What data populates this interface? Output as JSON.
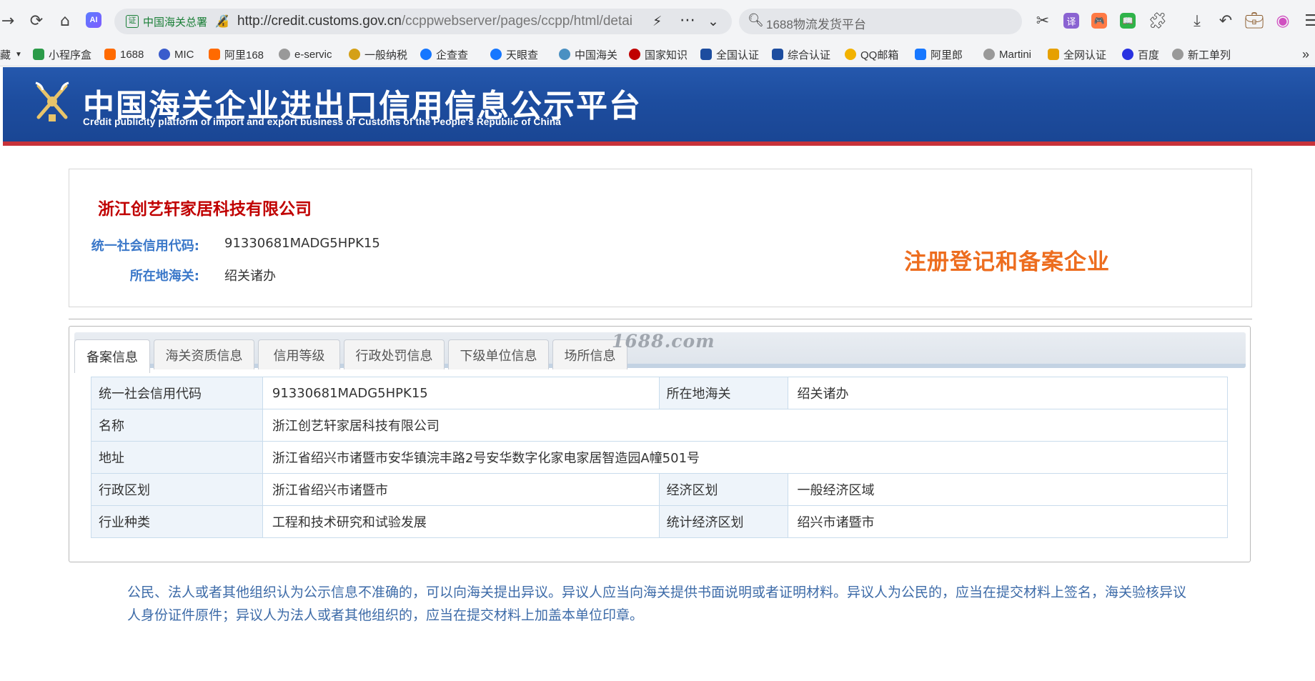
{
  "browser": {
    "site_chip": "中国海关总署",
    "site_chip_badge": "证",
    "url_main": "http://credit.customs.gov.cn",
    "url_rest": "/ccppwebserver/pages/ccpp/html/detai",
    "search_text": "1688物流发货平台",
    "ai_badge": "AI",
    "extensions": [
      {
        "icon": "translate-icon",
        "label": "译",
        "color": "#8a63d2"
      },
      {
        "icon": "game-icon",
        "label": "🎮",
        "color": "#ff7a45"
      },
      {
        "icon": "book-icon",
        "label": "📖",
        "color": "#2fb34a"
      }
    ]
  },
  "bookmarks": [
    {
      "label": "藏",
      "color": "#f3f4f6"
    },
    {
      "label": "小程序盒",
      "color": "#2b9b49"
    },
    {
      "label": "1688",
      "color": "#ff6a00"
    },
    {
      "label": "MIC",
      "color": "#3a5ccc"
    },
    {
      "label": "阿里168",
      "color": "#ff6a00"
    },
    {
      "label": "e-servic",
      "color": "#999999"
    },
    {
      "label": "一般纳税",
      "color": "#d4a017"
    },
    {
      "label": "企查查",
      "color": "#1677ff"
    },
    {
      "label": "天眼查",
      "color": "#1677ff"
    },
    {
      "label": "中国海关",
      "color": "#4a90c2"
    },
    {
      "label": "国家知识",
      "color": "#c00000"
    },
    {
      "label": "全国认证",
      "color": "#1d4d9f"
    },
    {
      "label": "综合认证",
      "color": "#1d4d9f"
    },
    {
      "label": "QQ邮箱",
      "color": "#f2b200"
    },
    {
      "label": "阿里郎",
      "color": "#1677ff"
    },
    {
      "label": "Martini",
      "color": "#999999"
    },
    {
      "label": "全网认证",
      "color": "#e6a000"
    },
    {
      "label": "百度",
      "color": "#2932e1"
    },
    {
      "label": "新工单列",
      "color": "#999999"
    }
  ],
  "banner": {
    "title": "中国海关企业进出口信用信息公示平台",
    "subtitle": "Credit publicity platform of import and export business of Customs of the People's Republic of China"
  },
  "company": {
    "name": "浙江创艺轩家居科技有限公司",
    "credit_code_label": "统一社会信用代码:",
    "credit_code": "91330681MADG5HPK15",
    "customs_label": "所在地海关:",
    "customs": "绍关诸办",
    "status_stamp": "注册登记和备案企业"
  },
  "tabs": [
    {
      "label": "备案信息",
      "active": true
    },
    {
      "label": "海关资质信息",
      "active": false
    },
    {
      "label": "信用等级",
      "active": false
    },
    {
      "label": "行政处罚信息",
      "active": false
    },
    {
      "label": "下级单位信息",
      "active": false
    },
    {
      "label": "场所信息",
      "active": false
    }
  ],
  "watermark": "1688.com",
  "details": {
    "r1": {
      "l1": "统一社会信用代码",
      "v1": "91330681MADG5HPK15",
      "l2": "所在地海关",
      "v2": "绍关诸办"
    },
    "r2": {
      "l1": "名称",
      "v1": "浙江创艺轩家居科技有限公司"
    },
    "r3": {
      "l1": "地址",
      "v1": "浙江省绍兴市诸暨市安华镇浣丰路2号安华数字化家电家居智造园A幢501号"
    },
    "r4": {
      "l1": "行政区划",
      "v1": "浙江省绍兴市诸暨市",
      "l2": "经济区划",
      "v2": "一般经济区域"
    },
    "r5": {
      "l1": "行业种类",
      "v1": "工程和技术研究和试验发展",
      "l2": "统计经济区划",
      "v2": "绍兴市诸暨市"
    }
  },
  "notice": "公民、法人或者其他组织认为公示信息不准确的，可以向海关提出异议。异议人应当向海关提供书面说明或者证明材料。异议人为公民的，应当在提交材料上签名，海关验核异议人身份证件原件；异议人为法人或者其他组织的，应当在提交材料上加盖本单位印章。"
}
